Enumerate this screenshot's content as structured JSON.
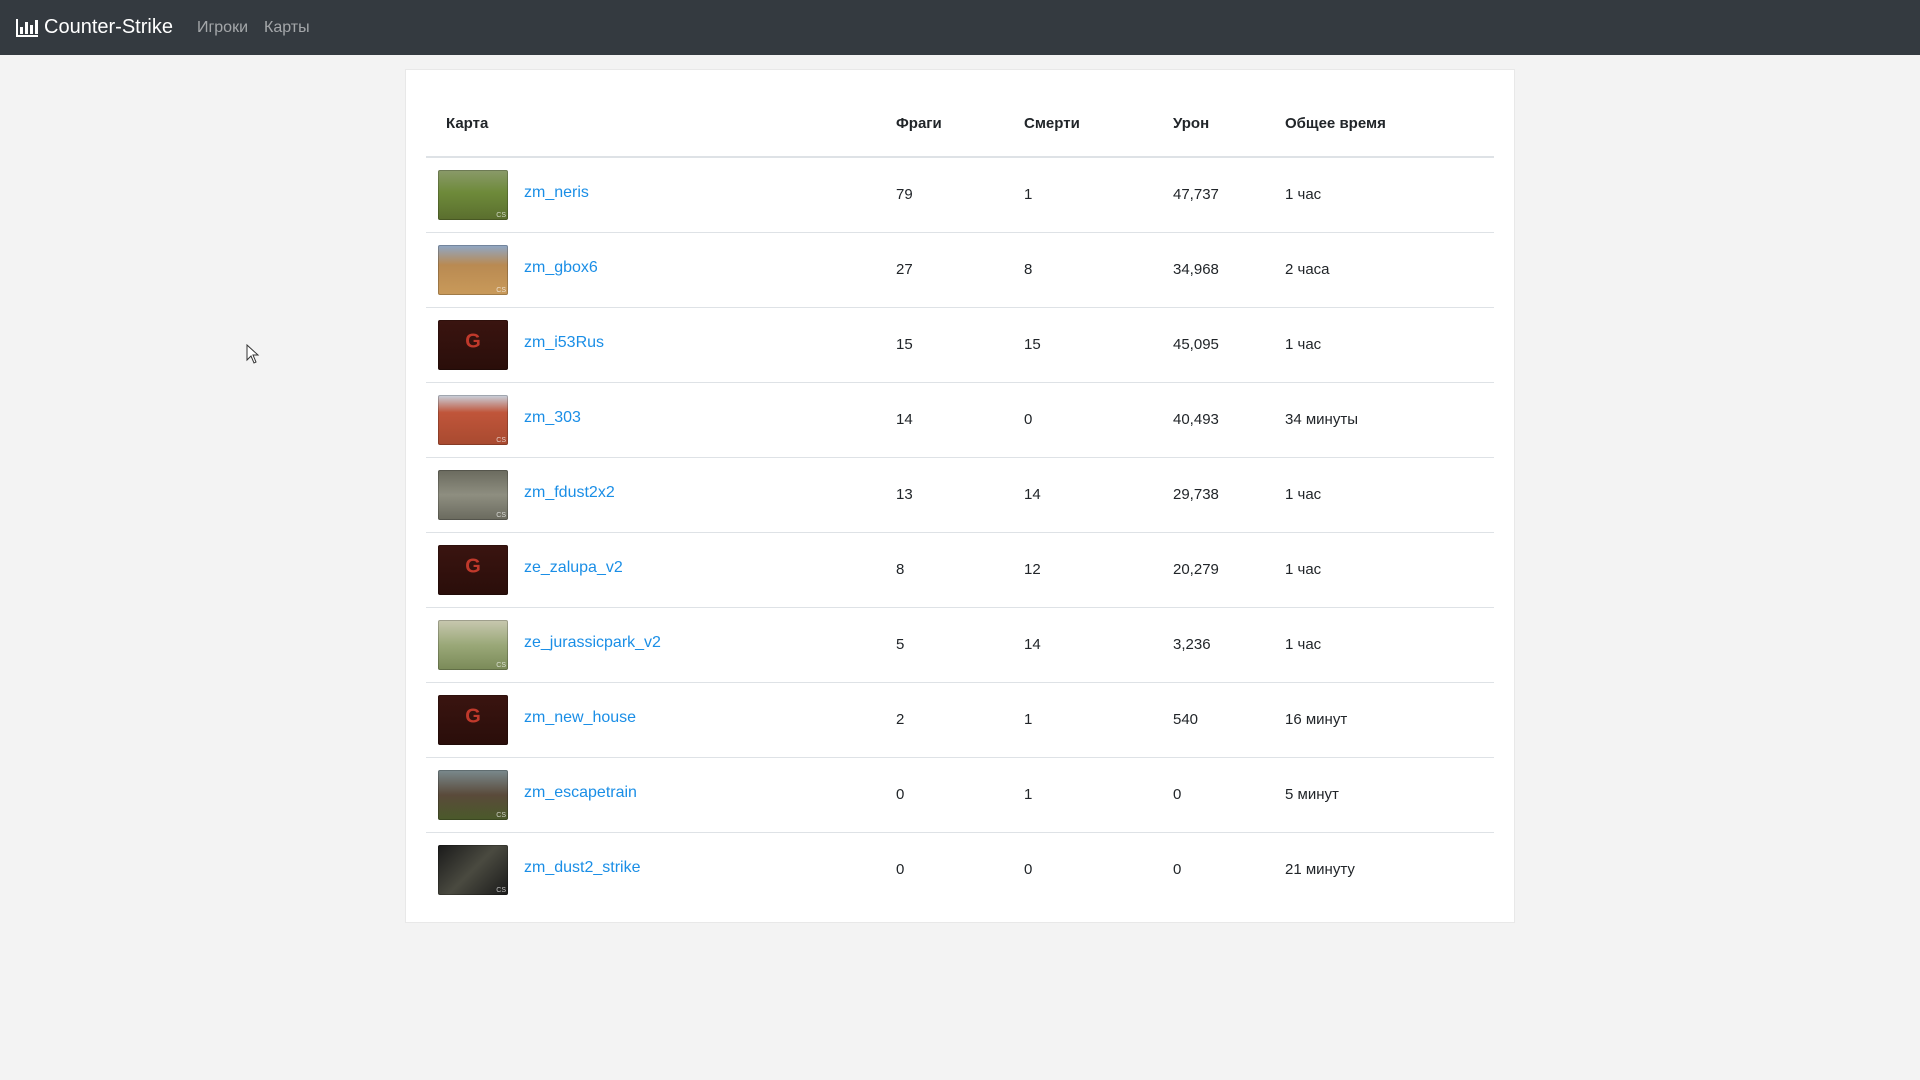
{
  "navbar": {
    "brand": "Counter-Strike",
    "links": [
      "Игроки",
      "Карты"
    ]
  },
  "table": {
    "headers": [
      "Карта",
      "Фраги",
      "Смерти",
      "Урон",
      "Общее время"
    ],
    "rows": [
      {
        "map": "zm_neris",
        "frags": "79",
        "deaths": "1",
        "damage": "47,737",
        "time": "1 час",
        "thumb": "green"
      },
      {
        "map": "zm_gbox6",
        "frags": "27",
        "deaths": "8",
        "damage": "34,968",
        "time": "2 часа",
        "thumb": "sand"
      },
      {
        "map": "zm_i53Rus",
        "frags": "15",
        "deaths": "15",
        "damage": "45,095",
        "time": "1 час",
        "thumb": "logo"
      },
      {
        "map": "zm_303",
        "frags": "14",
        "deaths": "0",
        "damage": "40,493",
        "time": "34 минуты",
        "thumb": "brick"
      },
      {
        "map": "zm_fdust2x2",
        "frags": "13",
        "deaths": "14",
        "damage": "29,738",
        "time": "1 час",
        "thumb": "grey"
      },
      {
        "map": "ze_zalupa_v2",
        "frags": "8",
        "deaths": "12",
        "damage": "20,279",
        "time": "1 час",
        "thumb": "logo"
      },
      {
        "map": "ze_jurassicpark_v2",
        "frags": "5",
        "deaths": "14",
        "damage": "3,236",
        "time": "1 час",
        "thumb": "field"
      },
      {
        "map": "zm_new_house",
        "frags": "2",
        "deaths": "1",
        "damage": "540",
        "time": "16 минут",
        "thumb": "logo"
      },
      {
        "map": "zm_escapetrain",
        "frags": "0",
        "deaths": "1",
        "damage": "0",
        "time": "5 минут",
        "thumb": "rail"
      },
      {
        "map": "zm_dust2_strike",
        "frags": "0",
        "deaths": "0",
        "damage": "0",
        "time": "21 минуту",
        "thumb": "dark"
      }
    ]
  },
  "colors": {
    "navbar_bg": "#343a40",
    "link": "#1a8ee6",
    "page_bg": "#f3f3f3"
  },
  "icons": {
    "brand": "bar-chart-icon"
  }
}
